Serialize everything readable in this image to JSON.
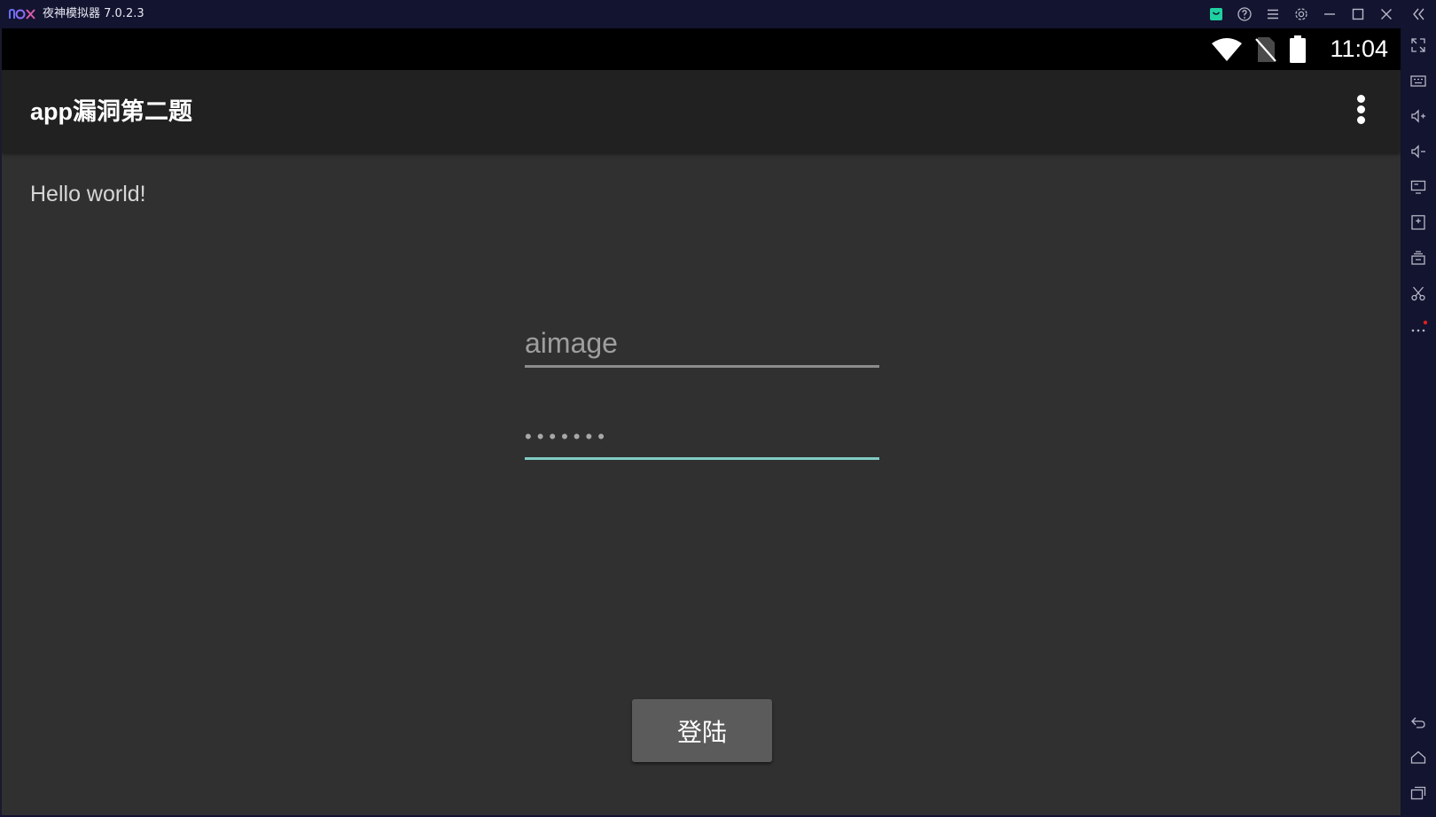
{
  "window": {
    "title": "夜神模拟器 7.0.2.3"
  },
  "titlebar_icons": [
    "shop-icon",
    "help-icon",
    "menu-icon",
    "settings-icon",
    "minimize-icon",
    "maximize-icon",
    "close-icon",
    "collapse-sidebar-icon"
  ],
  "status_bar": {
    "time": "11:04",
    "icons": [
      "wifi-icon",
      "no-sim-icon",
      "battery-icon"
    ]
  },
  "action_bar": {
    "title": "app漏洞第二题"
  },
  "content": {
    "hello_text": "Hello world!"
  },
  "form": {
    "username_placeholder": "aimage",
    "password_value": "•••••••",
    "login_label": "登陆"
  },
  "sidebar": {
    "items": [
      "fullscreen-icon",
      "keyboard-icon",
      "volume-up-icon",
      "volume-down-icon",
      "screen-icon",
      "install-apk-icon",
      "multi-instance-icon",
      "screenshot-icon",
      "more-icon",
      "back-icon",
      "home-icon",
      "recents-icon"
    ]
  },
  "colors": {
    "title_bar": "#121430",
    "screen_bg": "#303030",
    "action_bar": "#212121",
    "accent_underline": "#80cbc4",
    "button_bg": "#5b5b5b",
    "shop_icon": "#1fd1a0",
    "notification_dot": "#e02020"
  }
}
